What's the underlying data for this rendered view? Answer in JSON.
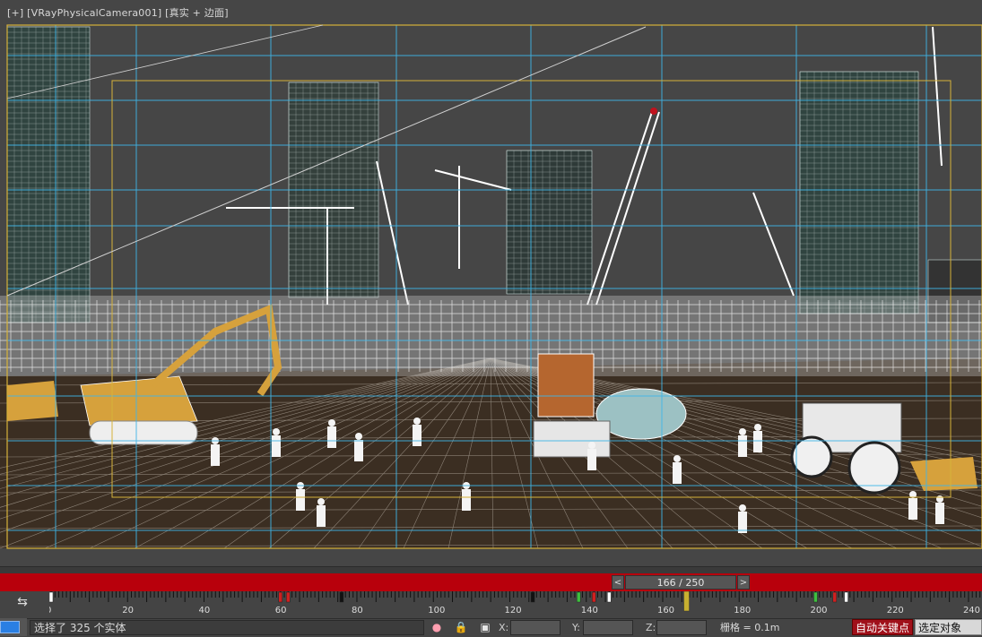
{
  "viewport": {
    "label_plus": "[+]",
    "label_camera": "[VRayPhysicalCamera001]",
    "label_mode": "[真实 + 边面]"
  },
  "time_slider": {
    "prev": "<",
    "position": "166 / 250",
    "next": ">",
    "current_frame": 166,
    "total_frames": 250
  },
  "track_bar": {
    "ticks": [
      "0",
      "20",
      "40",
      "60",
      "80",
      "100",
      "120",
      "140",
      "160",
      "180",
      "200",
      "220",
      "240"
    ]
  },
  "status_bar": {
    "prompt": "选择了 325 个实体",
    "x_label": "X:",
    "y_label": "Y:",
    "z_label": "Z:",
    "grid": "栅格 = 0.1m",
    "auto_key": "自动关键点",
    "selected": "选定对象"
  },
  "colors": {
    "viewport_bg": "#464646",
    "time_bar": "#b8000c",
    "auto_key": "#a0101a",
    "grid_lines": "#3fb6e8",
    "safe_frame": "#d6b23a"
  },
  "icons": {
    "track_toggle": "track-toggle-icon",
    "lock": "lock-icon",
    "snap": "snap-icon",
    "light": "isolate-icon"
  }
}
